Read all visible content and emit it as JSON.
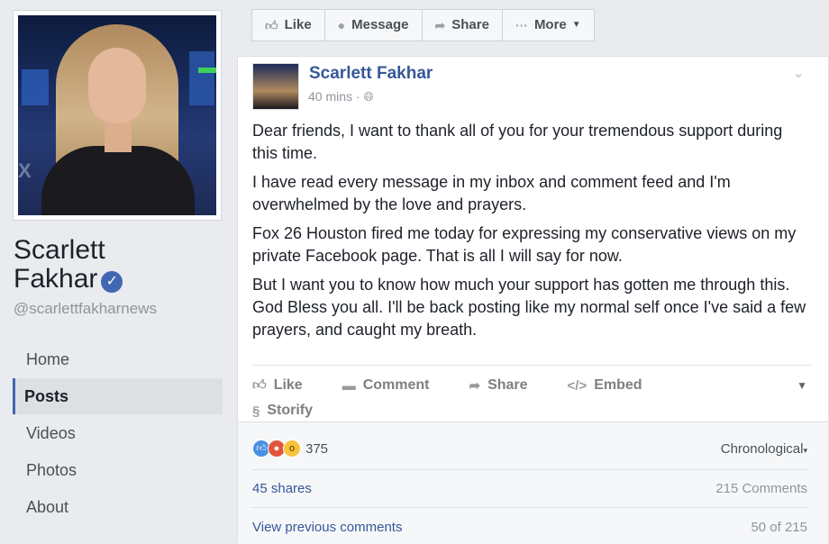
{
  "profile": {
    "name_line1": "Scarlett",
    "name_line2": "Fakhar",
    "handle": "@scarlettfakharnews",
    "verified_icon": "verified-check-icon"
  },
  "nav": {
    "items": [
      {
        "label": "Home",
        "active": false
      },
      {
        "label": "Posts",
        "active": true
      },
      {
        "label": "Videos",
        "active": false
      },
      {
        "label": "Photos",
        "active": false
      },
      {
        "label": "About",
        "active": false
      }
    ]
  },
  "actionbar": {
    "like": "Like",
    "message": "Message",
    "share": "Share",
    "more": "More"
  },
  "post": {
    "author": "Scarlett Fakhar",
    "time": "40 mins",
    "paragraphs": [
      "Dear friends, I want to thank all of you for your tremendous support during this time.",
      "I have read every message in my inbox and comment feed and I'm overwhelmed by the love and prayers.",
      "Fox 26 Houston fired me today for expressing my conservative views on my private Facebook page. That is all I will say for now.",
      "But I want you to know how much your support has gotten me through this. God Bless you all. I'll be back posting like my normal self once I've said a few prayers, and caught my breath."
    ],
    "actions": {
      "like": "Like",
      "comment": "Comment",
      "share": "Share",
      "embed": "Embed",
      "storify": "Storify"
    }
  },
  "reactions": {
    "count": "375",
    "sort": "Chronological",
    "shares": "45 shares",
    "comments": "215 Comments",
    "view_previous": "View previous comments",
    "page_count": "50 of 215"
  },
  "colors": {
    "accent": "#4267b2",
    "link": "#365899",
    "background": "#e9ebee"
  }
}
